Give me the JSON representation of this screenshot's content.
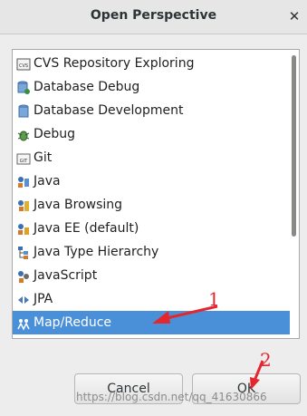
{
  "window": {
    "title": "Open Perspective",
    "close_glyph": "✕"
  },
  "list": {
    "items": [
      {
        "label": "CVS Repository Exploring",
        "icon": "cvs-icon"
      },
      {
        "label": "Database Debug",
        "icon": "database-debug-icon"
      },
      {
        "label": "Database Development",
        "icon": "database-development-icon"
      },
      {
        "label": "Debug",
        "icon": "bug-icon"
      },
      {
        "label": "Git",
        "icon": "git-icon"
      },
      {
        "label": "Java",
        "icon": "java-icon"
      },
      {
        "label": "Java Browsing",
        "icon": "java-browsing-icon"
      },
      {
        "label": "Java EE (default)",
        "icon": "java-ee-icon"
      },
      {
        "label": "Java Type Hierarchy",
        "icon": "hierarchy-icon"
      },
      {
        "label": "JavaScript",
        "icon": "javascript-icon"
      },
      {
        "label": "JPA",
        "icon": "jpa-icon"
      },
      {
        "label": "Map/Reduce",
        "icon": "map-reduce-icon",
        "selected": true
      }
    ]
  },
  "buttons": {
    "cancel_label": "Cancel",
    "ok_label": "OK"
  },
  "annotations": {
    "one": "1",
    "two": "2"
  },
  "watermark": "https://blog.csdn.net/qq_41630866",
  "colors": {
    "selection": "#4a90d9",
    "annotation": "#e4262e"
  }
}
